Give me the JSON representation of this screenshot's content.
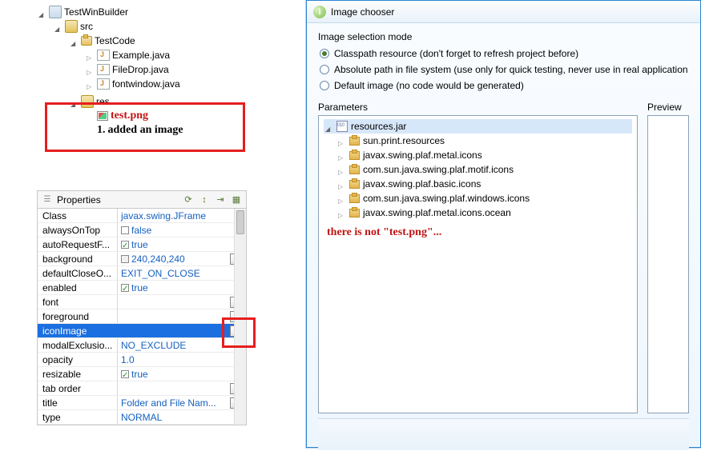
{
  "tree": {
    "project": "TestWinBuilder",
    "src": "src",
    "pkg": "TestCode",
    "files": [
      "Example.java",
      "FileDrop.java",
      "fontwindow.java"
    ],
    "res_folder": "res",
    "res_file": "test.png",
    "annotation": "added an image",
    "annotation_num": "1."
  },
  "props_panel": {
    "title": "Properties",
    "rows": [
      {
        "name": "Class",
        "value": "javax.swing.JFrame",
        "kind": "text"
      },
      {
        "name": "alwaysOnTop",
        "value": "false",
        "kind": "check_off"
      },
      {
        "name": "autoRequestF...",
        "value": "true",
        "kind": "check_on"
      },
      {
        "name": "background",
        "value": "240,240,240",
        "kind": "swatch"
      },
      {
        "name": "defaultCloseO...",
        "value": "EXIT_ON_CLOSE",
        "kind": "text"
      },
      {
        "name": "enabled",
        "value": "true",
        "kind": "check_on"
      },
      {
        "name": "font",
        "value": "",
        "kind": "ellipsis"
      },
      {
        "name": "foreground",
        "value": "",
        "kind": "ellipsis"
      },
      {
        "name": "iconImage",
        "value": "",
        "kind": "ellipsis",
        "selected": true
      },
      {
        "name": "modalExclusio...",
        "value": "NO_EXCLUDE",
        "kind": "text"
      },
      {
        "name": "opacity",
        "value": "1.0",
        "kind": "text"
      },
      {
        "name": "resizable",
        "value": "true",
        "kind": "check_on"
      },
      {
        "name": "tab order",
        "value": "",
        "kind": "ellipsis"
      },
      {
        "name": "title",
        "value": "Folder and File Nam...",
        "kind": "ellipsis_text"
      },
      {
        "name": "type",
        "value": "NORMAL",
        "kind": "text"
      }
    ]
  },
  "dialog": {
    "title": "Image chooser",
    "group_label": "Image selection mode",
    "radios": [
      {
        "label": "Classpath resource (don't forget to refresh project before)",
        "checked": true
      },
      {
        "label": "Absolute path in file system (use only for quick testing, never use in real application",
        "checked": false
      },
      {
        "label": "Default image (no code would be generated)",
        "checked": false
      }
    ],
    "params_title": "Parameters",
    "preview_title": "Preview",
    "jar_root": "resources.jar",
    "packages": [
      "sun.print.resources",
      "javax.swing.plaf.metal.icons",
      "com.sun.java.swing.plaf.motif.icons",
      "javax.swing.plaf.basic.icons",
      "com.sun.java.swing.plaf.windows.icons",
      "javax.swing.plaf.metal.icons.ocean"
    ],
    "annotation": "there is not \"test.png\"..."
  }
}
